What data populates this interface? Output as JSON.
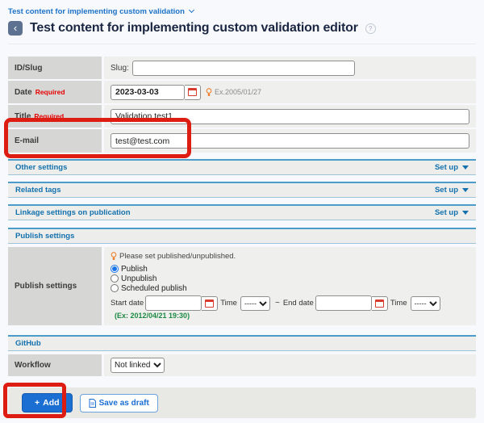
{
  "icons": {
    "back": "‹",
    "help": "?",
    "plus": "+"
  },
  "breadcrumb": {
    "label": "Test content for implementing custom validation"
  },
  "header": {
    "title": "Test content for implementing custom validation editor"
  },
  "form": {
    "slug": {
      "label": "ID/Slug",
      "prefix": "Slug:",
      "value": ""
    },
    "date": {
      "label": "Date",
      "required": "Required",
      "value": "2023-03-03",
      "example": "Ex.2005/01/27"
    },
    "title": {
      "label": "Title",
      "required": "Required",
      "value": "Validation test1"
    },
    "email": {
      "label": "E-mail",
      "value": "test@test.com"
    }
  },
  "sections": [
    {
      "label": "Other settings",
      "action": "Set up"
    },
    {
      "label": "Related tags",
      "action": "Set up"
    },
    {
      "label": "Linkage settings on publication",
      "action": "Set up"
    }
  ],
  "publish": {
    "heading": "Publish settings",
    "row_label": "Publish settings",
    "hint": "Please set published/unpublished.",
    "options": [
      {
        "label": "Publish",
        "selected": true
      },
      {
        "label": "Unpublish",
        "selected": false
      },
      {
        "label": "Scheduled publish",
        "selected": false
      }
    ],
    "start_label": "Start date",
    "start_value": "",
    "time_label": "Time",
    "time_value": "-----",
    "tilde": "~",
    "end_label": "End date",
    "end_value": "",
    "example": "(Ex: 2012/04/21 19:30)"
  },
  "github": {
    "heading": "GitHub"
  },
  "workflow": {
    "label": "Workflow",
    "value": "Not linked"
  },
  "footer": {
    "add_label": "Add",
    "save_draft_label": "Save as draft"
  },
  "colors": {
    "accent_blue": "#1b6fd3",
    "section_blue": "#1371ae",
    "required_red": "#e60000",
    "annotation_red": "#dd1d12",
    "example_green": "#1d8a44",
    "label_cell_gray": "#d6d6d5",
    "content_cell_gray": "#efefed"
  }
}
